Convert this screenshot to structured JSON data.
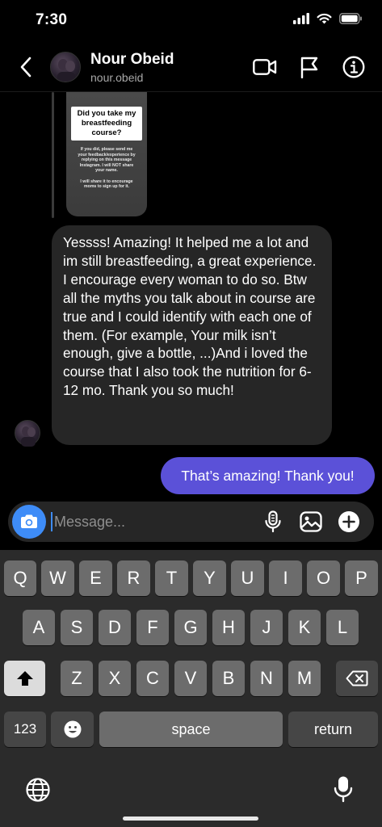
{
  "status_bar": {
    "time": "7:30"
  },
  "header": {
    "name": "Nour Obeid",
    "username": "nour.obeid"
  },
  "story": {
    "title": "Did you take my breastfeeding course?",
    "body": "If you did, please send me your feedback/experience by replying on this message Instagram. I will NOT share your name.",
    "body2": "I will share it to encourage moms to sign up for it."
  },
  "messages": {
    "received": "Yessss! Amazing! It helped me a lot and im still breastfeeding, a great experience. I encourage every woman to do so. Btw all the myths you talk about in course are true and I could identify with each one of them. (For example, Your milk isn’t enough, give a bottle, ...)And i loved the course that I also took the nutrition for 6-12 mo. Thank you so much!",
    "sent": "That’s amazing! Thank you!"
  },
  "composer": {
    "placeholder": "Message..."
  },
  "keyboard": {
    "row1": [
      "Q",
      "W",
      "E",
      "R",
      "T",
      "Y",
      "U",
      "I",
      "O",
      "P"
    ],
    "row2": [
      "A",
      "S",
      "D",
      "F",
      "G",
      "H",
      "J",
      "K",
      "L"
    ],
    "row3": [
      "Z",
      "X",
      "C",
      "V",
      "B",
      "N",
      "M"
    ],
    "numbers_label": "123",
    "space_label": "space",
    "return_label": "return"
  },
  "colors": {
    "sent_bubble": "#5b51d8",
    "received_bubble": "#262626",
    "camera_button": "#3e8cf7",
    "background": "#000000"
  },
  "icons": {
    "status": [
      "cellular-signal-icon",
      "wifi-icon",
      "battery-icon"
    ],
    "header": [
      "back-chevron-icon",
      "video-call-icon",
      "report-flag-icon",
      "info-icon"
    ],
    "composer": [
      "camera-icon",
      "microphone-icon",
      "gallery-icon",
      "add-icon"
    ],
    "keyboard": [
      "shift-icon",
      "delete-icon",
      "emoji-icon",
      "globe-icon",
      "dictation-icon"
    ]
  }
}
